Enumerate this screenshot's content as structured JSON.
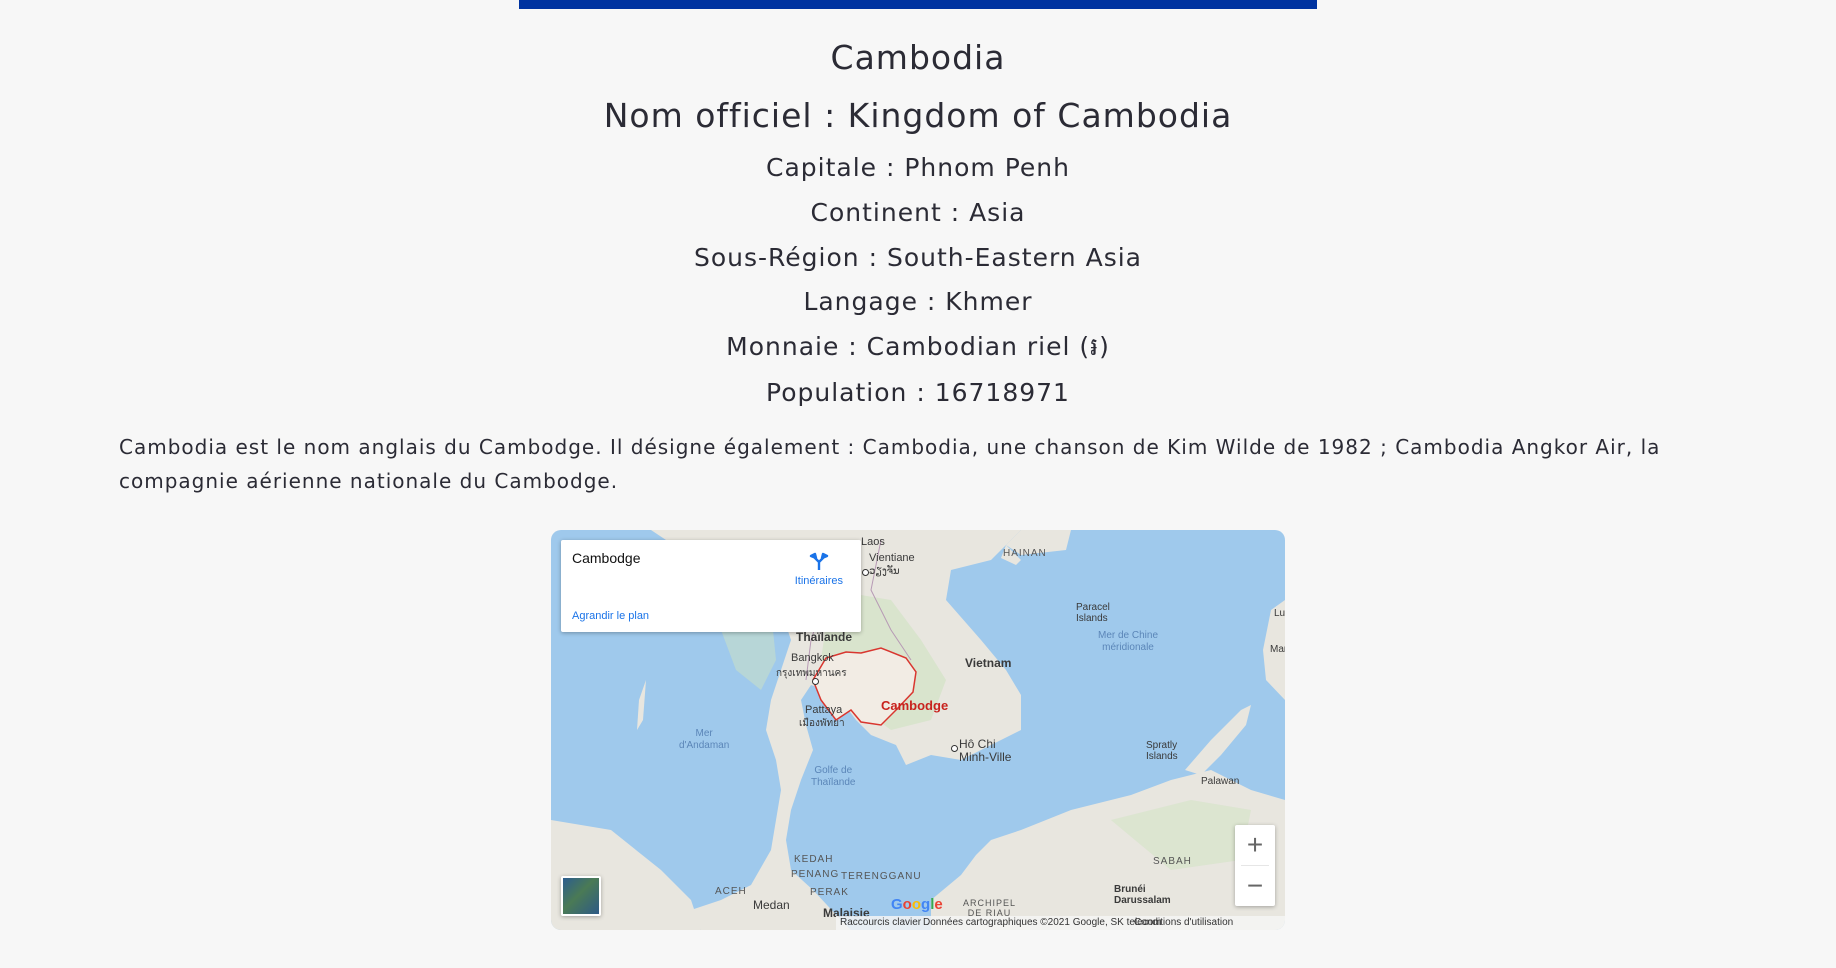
{
  "country": {
    "name": "Cambodia",
    "official": "Nom officiel : Kingdom of Cambodia",
    "capital": "Capitale : Phnom Penh",
    "continent": "Continent : Asia",
    "subregion": "Sous-Région : South-Eastern Asia",
    "language": "Langage : Khmer",
    "currency": "Monnaie : Cambodian riel (៛)",
    "population": "Population : 16718971"
  },
  "description": "Cambodia est le nom anglais du Cambodge. Il désigne également : Cambodia, une chanson de Kim Wilde de 1982 ; Cambodia Angkor Air, la compagnie aérienne nationale du Cambodge.",
  "colors": {
    "top_bar": "#0033a0",
    "sea": "#9fc9ec",
    "land": "#e8e6df",
    "border_highlight": "#c8231e"
  },
  "map": {
    "infobox": {
      "title": "Cambodge",
      "directions": "Itinéraires",
      "enlarge": "Agrandir le plan"
    },
    "labels": {
      "vientiane": "Vientiane",
      "vientiane_local": "ວຽງຈັນ",
      "laos": "Laos",
      "hainan": "HAINAN",
      "paracel": "Paracel\nIslands",
      "mer_chine": "Mer de Chine\nméridionale",
      "thailande": "Thaïlande",
      "bangkok": "Bangkok",
      "bangkok_local": "กรุงเทพมหานคร",
      "vietnam": "Vietnam",
      "pattaya": "Pattaya",
      "pattaya_local": "เมืองพัทยา",
      "cambodge": "Cambodge",
      "mer_andaman": "Mer\nd'Andaman",
      "hochiminh": "Hô Chi\nMinh-Ville",
      "golfe": "Golfe de\nThaïlande",
      "spratly": "Spratly\nIslands",
      "palawan": "Palawan",
      "kedah": "KEDAH",
      "penang": "PENANG",
      "terengganu": "TERENGGANU",
      "perak": "PERAK",
      "sabah": "SABAH",
      "brunei": "Brunéi\nDarussalam",
      "aceh": "ACEH",
      "medan": "Medan",
      "malaisie": "Malaisie",
      "archipel": "ARCHIPEL\nDE RIAU",
      "lu": "Lu",
      "man": "Man"
    },
    "footer": {
      "shortcuts": "Raccourcis clavier",
      "data": "Données cartographiques ©2021 Google, SK telecom",
      "terms": "Conditions d'utilisation"
    },
    "google_logo": [
      "G",
      "o",
      "o",
      "g",
      "l",
      "e"
    ],
    "zoom_in": "+",
    "zoom_out": "−",
    "icons": [
      "directions-icon",
      "layers-icon"
    ]
  }
}
